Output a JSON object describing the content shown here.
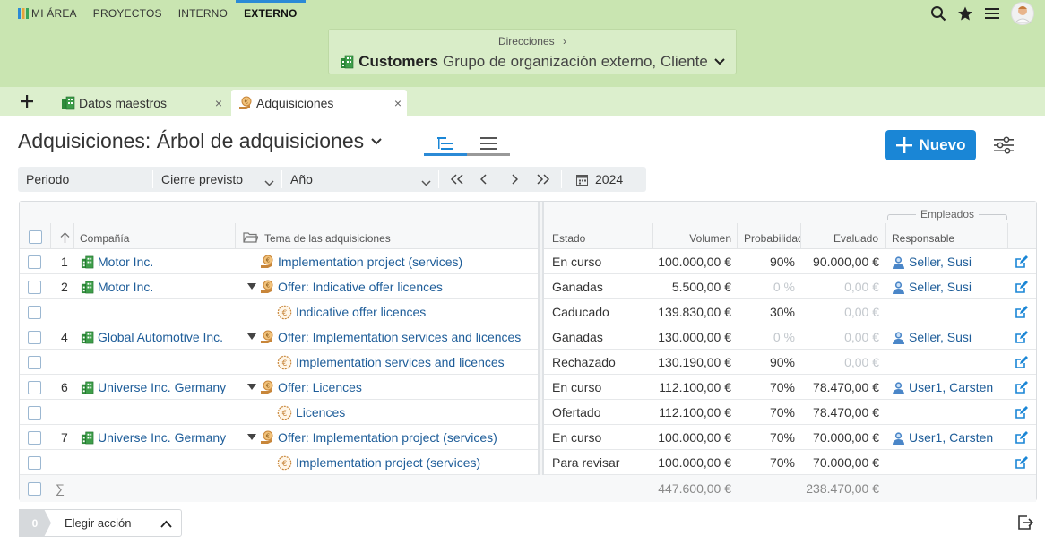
{
  "topnav": {
    "items": [
      {
        "label": "MI ÁREA",
        "active": false
      },
      {
        "label": "PROYECTOS",
        "active": false
      },
      {
        "label": "INTERNO",
        "active": false
      },
      {
        "label": "EXTERNO",
        "active": true
      }
    ]
  },
  "selector": {
    "breadcrumb": "Direcciones",
    "breadcrumb_arrow": "›",
    "title": "Customers",
    "subtitle": "Grupo de organización externo, Cliente"
  },
  "tabs": {
    "add": "+",
    "items": [
      {
        "label": "Datos maestros",
        "icon": "building-icon",
        "close": "×"
      },
      {
        "label": "Adquisiciones",
        "icon": "euro-hand-icon",
        "close": "×"
      }
    ]
  },
  "page": {
    "title": "Adquisiciones: Árbol de adquisiciones",
    "new_button": "Nuevo"
  },
  "filters": {
    "periodo": "Periodo",
    "cierre": "Cierre previsto",
    "unidad": "Año",
    "year": "2024"
  },
  "grid": {
    "group_header": "Empleados",
    "columns": {
      "company": "Compañía",
      "topic": "Tema de las adquisiciones",
      "status": "Estado",
      "volume": "Volumen",
      "probability": "Probabilidad",
      "evaluated": "Evaluado",
      "responsible": "Responsable"
    },
    "rows": [
      {
        "num": "1",
        "company": "Motor Inc.",
        "toggle": false,
        "topic": "Implementation project (services)",
        "sub": false,
        "status": "En curso",
        "volume": "100.000,00 €",
        "prob": "90%",
        "prob_muted": false,
        "eval": "90.000,00 €",
        "eval_muted": false,
        "resp": "Seller, Susi"
      },
      {
        "num": "2",
        "company": "Motor Inc.",
        "toggle": true,
        "topic": "Offer: Indicative offer licences",
        "sub": false,
        "status": "Ganadas",
        "volume": "5.500,00 €",
        "prob": "0 %",
        "prob_muted": true,
        "eval": "0,00 €",
        "eval_muted": true,
        "resp": "Seller, Susi"
      },
      {
        "num": "",
        "company": "",
        "toggle": false,
        "topic": "Indicative offer licences",
        "sub": true,
        "status": "Caducado",
        "volume": "139.830,00 €",
        "prob": "30%",
        "prob_muted": false,
        "eval": "0,00 €",
        "eval_muted": true,
        "resp": ""
      },
      {
        "num": "4",
        "company": "Global Automotive Inc.",
        "toggle": true,
        "topic": "Offer: Implementation services and licences",
        "sub": false,
        "status": "Ganadas",
        "volume": "130.000,00 €",
        "prob": "0 %",
        "prob_muted": true,
        "eval": "0,00 €",
        "eval_muted": true,
        "resp": "Seller, Susi"
      },
      {
        "num": "",
        "company": "",
        "toggle": false,
        "topic": "Implementation services and licences",
        "sub": true,
        "status": "Rechazado",
        "volume": "130.190,00 €",
        "prob": "90%",
        "prob_muted": false,
        "eval": "0,00 €",
        "eval_muted": true,
        "resp": ""
      },
      {
        "num": "6",
        "company": "Universe Inc. Germany",
        "toggle": true,
        "topic": "Offer: Licences",
        "sub": false,
        "status": "En curso",
        "volume": "112.100,00 €",
        "prob": "70%",
        "prob_muted": false,
        "eval": "78.470,00 €",
        "eval_muted": false,
        "resp": "User1, Carsten"
      },
      {
        "num": "",
        "company": "",
        "toggle": false,
        "topic": "Licences",
        "sub": true,
        "status": "Ofertado",
        "volume": "112.100,00 €",
        "prob": "70%",
        "prob_muted": false,
        "eval": "78.470,00 €",
        "eval_muted": false,
        "resp": ""
      },
      {
        "num": "7",
        "company": "Universe Inc. Germany",
        "toggle": true,
        "topic": "Offer: Implementation project (services)",
        "sub": false,
        "status": "En curso",
        "volume": "100.000,00 €",
        "prob": "70%",
        "prob_muted": false,
        "eval": "70.000,00 €",
        "eval_muted": false,
        "resp": "User1, Carsten"
      },
      {
        "num": "",
        "company": "",
        "toggle": false,
        "topic": "Implementation project (services)",
        "sub": true,
        "status": "Para revisar",
        "volume": "100.000,00 €",
        "prob": "70%",
        "prob_muted": false,
        "eval": "70.000,00 €",
        "eval_muted": false,
        "resp": ""
      }
    ],
    "totals": {
      "sigma": "∑",
      "volume": "447.600,00 €",
      "evaluated": "238.470,00 €"
    }
  },
  "bottom": {
    "count": "0",
    "action_label": "Elegir acción"
  },
  "colors": {
    "header_bg": "#c9e5b1",
    "accent": "#1a86d6",
    "link": "#1e5d99",
    "org_icon": "#2e8b3a",
    "money_icon": "#c8863a"
  }
}
